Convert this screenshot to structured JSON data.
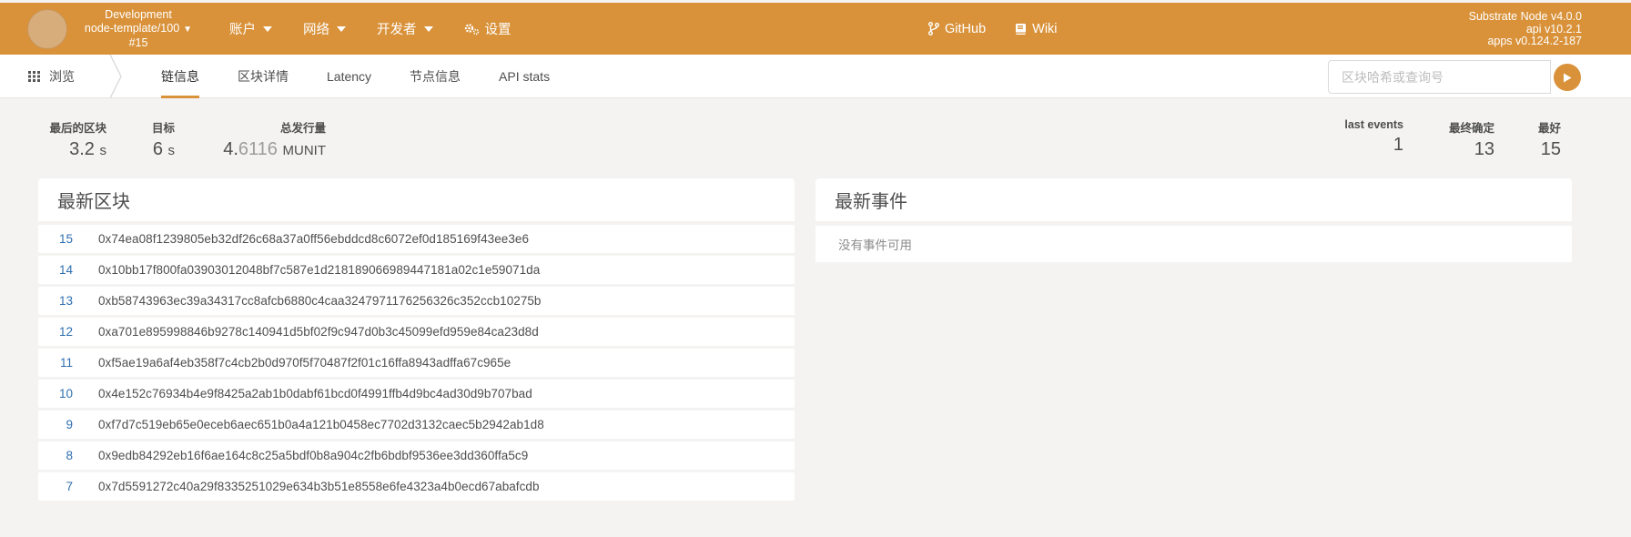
{
  "header": {
    "chain_name": "Development",
    "chain_node": "node-template/100",
    "chain_block": "#15",
    "menu": [
      {
        "label": "账户"
      },
      {
        "label": "网络"
      },
      {
        "label": "开发者"
      }
    ],
    "settings_label": "设置",
    "github_label": "GitHub",
    "wiki_label": "Wiki",
    "version_node": "Substrate Node v4.0.0",
    "version_api": "api v10.2.1",
    "version_apps": "apps v0.124.2-187",
    "accent_color": "#d9923a"
  },
  "subnav": {
    "browse_label": "浏览",
    "tabs": [
      {
        "label": "链信息"
      },
      {
        "label": "区块详情"
      },
      {
        "label": "Latency"
      },
      {
        "label": "节点信息"
      },
      {
        "label": "API stats"
      }
    ],
    "search_placeholder": "区块哈希或查询号"
  },
  "summary": {
    "last_block_label": "最后的区块",
    "last_block_value": "3.2",
    "last_block_unit": "s",
    "target_label": "目标",
    "target_value": "6",
    "target_unit": "s",
    "issuance_label": "总发行量",
    "issuance_int": "4.",
    "issuance_frac": "6116",
    "issuance_unit": "MUNIT",
    "last_events_label": "last events",
    "last_events_value": "1",
    "finalized_label": "最终确定",
    "finalized_value": "13",
    "best_label": "最好",
    "best_value": "15"
  },
  "blocks": {
    "title": "最新区块",
    "rows": [
      {
        "num": "15",
        "hash": "0x74ea08f1239805eb32df26c68a37a0ff56ebddcd8c6072ef0d185169f43ee3e6"
      },
      {
        "num": "14",
        "hash": "0x10bb17f800fa03903012048bf7c587e1d218189066989447181a02c1e59071da"
      },
      {
        "num": "13",
        "hash": "0xb58743963ec39a34317cc8afcb6880c4caa3247971176256326c352ccb10275b"
      },
      {
        "num": "12",
        "hash": "0xa701e895998846b9278c140941d5bf02f9c947d0b3c45099efd959e84ca23d8d"
      },
      {
        "num": "11",
        "hash": "0xf5ae19a6af4eb358f7c4cb2b0d970f5f70487f2f01c16ffa8943adffa67c965e"
      },
      {
        "num": "10",
        "hash": "0x4e152c76934b4e9f8425a2ab1b0dabf61bcd0f4991ffb4d9bc4ad30d9b707bad"
      },
      {
        "num": "9",
        "hash": "0xf7d7c519eb65e0eceb6aec651b0a4a121b0458ec7702d3132caec5b2942ab1d8"
      },
      {
        "num": "8",
        "hash": "0x9edb84292eb16f6ae164c8c25a5bdf0b8a904c2fb6bdbf9536ee3dd360ffa5c9"
      },
      {
        "num": "7",
        "hash": "0x7d5591272c40a29f8335251029e634b3b51e8558e6fe4323a4b0ecd67abafcdb"
      }
    ]
  },
  "events": {
    "title": "最新事件",
    "empty_text": "没有事件可用"
  }
}
